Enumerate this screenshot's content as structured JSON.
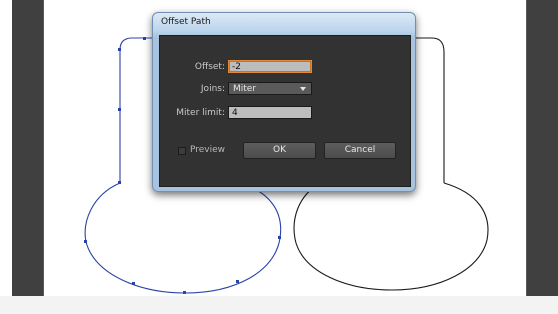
{
  "dialog": {
    "title": "Offset Path",
    "offset": {
      "label": "Offset:",
      "value": "-2"
    },
    "joins": {
      "label": "Joins:",
      "value": "Miter"
    },
    "miter_limit": {
      "label": "Miter limit:",
      "value": "4"
    },
    "preview": {
      "label": "Preview",
      "checked": false
    },
    "ok_label": "OK",
    "cancel_label": "Cancel"
  },
  "colors": {
    "workspace_panel": "#404040",
    "artboard": "#ffffff",
    "selected_path": "#2b43a6",
    "unselected_path": "#1a1a1a",
    "dialog_body": "#323232",
    "focus_ring": "#e08a3a"
  }
}
